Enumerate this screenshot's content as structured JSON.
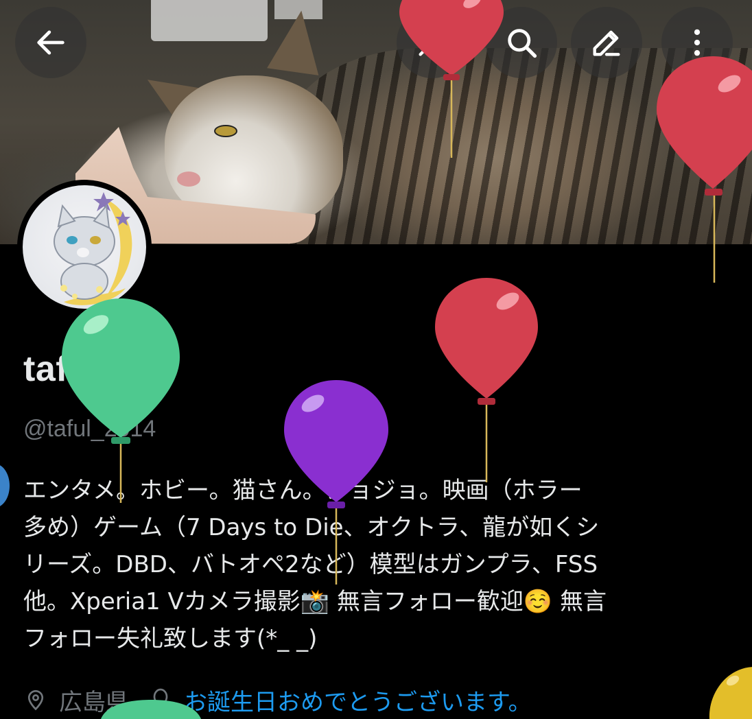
{
  "header": {
    "back_icon": "arrow-left-icon",
    "grok_icon": "grok-icon",
    "search_icon": "search-icon",
    "edit_icon": "pencil-icon",
    "more_icon": "more-vertical-icon"
  },
  "profile": {
    "display_name": "tafull",
    "handle": "@taful_2014",
    "bio_lines": [
      "エンタメ。ホビー。猫さん。ジョジョ。映画（ホラー",
      "多め）ゲーム（7 Days to Die、オクトラ、龍が如くシ",
      "リーズ。DBD、バトオペ2など）模型はガンプラ、FSS",
      "他。Xperia1 Vカメラ撮影📸 無言フォロー歓迎☺️ 無言",
      "フォロー失礼致します(*_ _)"
    ],
    "location": "広島県",
    "birthday_message": "お誕生日おめでとうございます。"
  },
  "colors": {
    "background": "#000000",
    "text_primary": "#e7e9ea",
    "text_secondary": "#71767b",
    "link": "#1d9bf0",
    "balloon_red": "#d4404f",
    "balloon_green": "#4ec98f",
    "balloon_purple": "#8a2fd0",
    "balloon_yellow": "#e3be2a"
  }
}
